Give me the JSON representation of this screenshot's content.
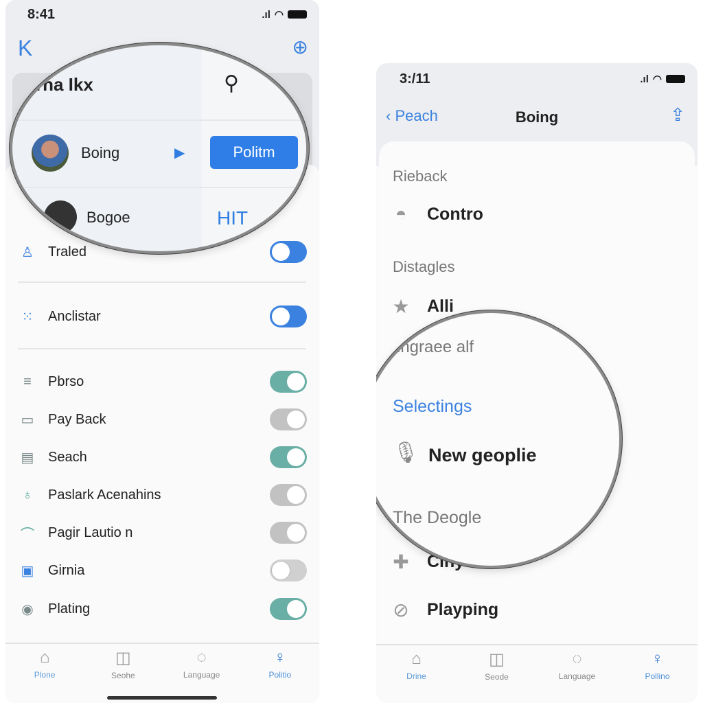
{
  "left_phone": {
    "status": {
      "time": "8:41"
    },
    "nav": {
      "back": "K",
      "settings_icon": "crosshair-gear-icon"
    },
    "magnified": {
      "title": "rha Ikx",
      "rows": [
        {
          "name": "Boing",
          "button": "Politm"
        },
        {
          "name": "Bogoe",
          "tag": "HIT"
        }
      ]
    },
    "settings": [
      {
        "label": "Traled",
        "icon": "person-icon",
        "on": true,
        "color": "#3b82e0"
      },
      {
        "label": "Anclistar",
        "icon": "grid-icon",
        "on": true,
        "color": "#3b82e0"
      },
      {
        "label": "Pbrso",
        "icon": "menu-icon",
        "on": true,
        "color": "#6aafa5"
      },
      {
        "label": "Pay Back",
        "icon": "card-icon",
        "on": false,
        "color": "#c2c2c2"
      },
      {
        "label": "Seach",
        "icon": "document-icon",
        "on": true,
        "color": "#6aafa5"
      },
      {
        "label": "Paslark Acenahins",
        "icon": "leaf-icon",
        "on": false,
        "color": "#c2c2c2"
      },
      {
        "label": "Pagir Lautio n",
        "icon": "wifi-icon",
        "on": false,
        "color": "#c2c2c2"
      },
      {
        "label": "Girnia",
        "icon": "calendar-icon",
        "on": false,
        "color": "#d0d0d0"
      },
      {
        "label": "Plating",
        "icon": "coin-icon",
        "on": true,
        "color": "#6aafa5"
      }
    ],
    "tabs": [
      {
        "label": "Plone",
        "icon": "home-icon"
      },
      {
        "label": "Seohe",
        "icon": "chart-icon"
      },
      {
        "label": "Language",
        "icon": "bag-icon"
      },
      {
        "label": "Politio",
        "icon": "pin-icon"
      }
    ]
  },
  "right_phone": {
    "status": {
      "time": "3:/11"
    },
    "nav": {
      "back": "Peach",
      "title": "Boing",
      "share_icon": "share-icon"
    },
    "sections": [
      {
        "header": "Rieback",
        "item": "Contro",
        "icon": "dome-icon"
      },
      {
        "header": "Distagles",
        "item": "Alli",
        "icon": "star-icon"
      },
      {
        "header": "ingraee alf",
        "item": "",
        "icon": ""
      },
      {
        "header": "Selectings",
        "item": "New geoplie",
        "icon": "microphone-icon"
      },
      {
        "header": "The Deogle",
        "item": "Cinyu",
        "icon": "pin-tool-icon"
      },
      {
        "header": "",
        "item": "Playping",
        "icon": "search-circle-icon"
      }
    ],
    "tabs": [
      {
        "label": "Drine",
        "icon": "home-icon"
      },
      {
        "label": "Seode",
        "icon": "chart-icon"
      },
      {
        "label": "Language",
        "icon": "bag-icon"
      },
      {
        "label": "Pollino",
        "icon": "pin-icon"
      }
    ]
  }
}
